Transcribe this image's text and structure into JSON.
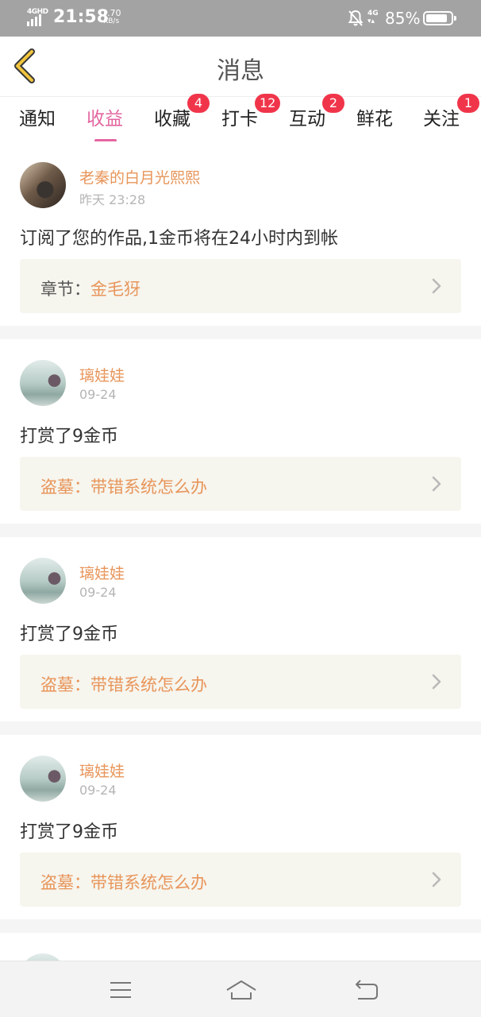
{
  "status_bar": {
    "network_label": "4GHD",
    "time": "21:58",
    "speed_value": "1.70",
    "speed_unit": "KB/s",
    "mobile_label": "4G",
    "battery_percent": "85%",
    "battery_level": 0.85
  },
  "header": {
    "title": "消息",
    "back_icon": "chevron-left-icon"
  },
  "tabs": [
    {
      "label": "通知",
      "badge": "",
      "active": false
    },
    {
      "label": "收益",
      "badge": "",
      "active": true
    },
    {
      "label": "收藏",
      "badge": "4",
      "active": false
    },
    {
      "label": "打卡",
      "badge": "12",
      "active": false
    },
    {
      "label": "互动",
      "badge": "2",
      "active": false
    },
    {
      "label": "鲜花",
      "badge": "",
      "active": false
    },
    {
      "label": "关注",
      "badge": "1",
      "active": false
    }
  ],
  "messages": [
    {
      "user": "老秦的白月光熙熙",
      "time": "昨天 23:28",
      "action": "订阅了您的作品,1金币将在24小时内到帐",
      "ref_prefix": "章节：",
      "ref_title": "金毛犽"
    },
    {
      "user": "璃娃娃",
      "time": "09-24",
      "action": "打赏了9金币",
      "ref_prefix": "盗墓：",
      "ref_title": "带错系统怎么办"
    },
    {
      "user": "璃娃娃",
      "time": "09-24",
      "action": "打赏了9金币",
      "ref_prefix": "盗墓：",
      "ref_title": "带错系统怎么办"
    },
    {
      "user": "璃娃娃",
      "time": "09-24",
      "action": "打赏了9金币",
      "ref_prefix": "盗墓：",
      "ref_title": "带错系统怎么办"
    }
  ],
  "colors": {
    "accent_pink": "#e466a0",
    "username_orange": "#e8955a",
    "badge_red": "#f0354a",
    "card_bg": "#f6f5ee"
  },
  "bottom_nav": {
    "menu_icon": "menu-icon",
    "home_icon": "home-icon",
    "back_icon": "back-icon"
  }
}
